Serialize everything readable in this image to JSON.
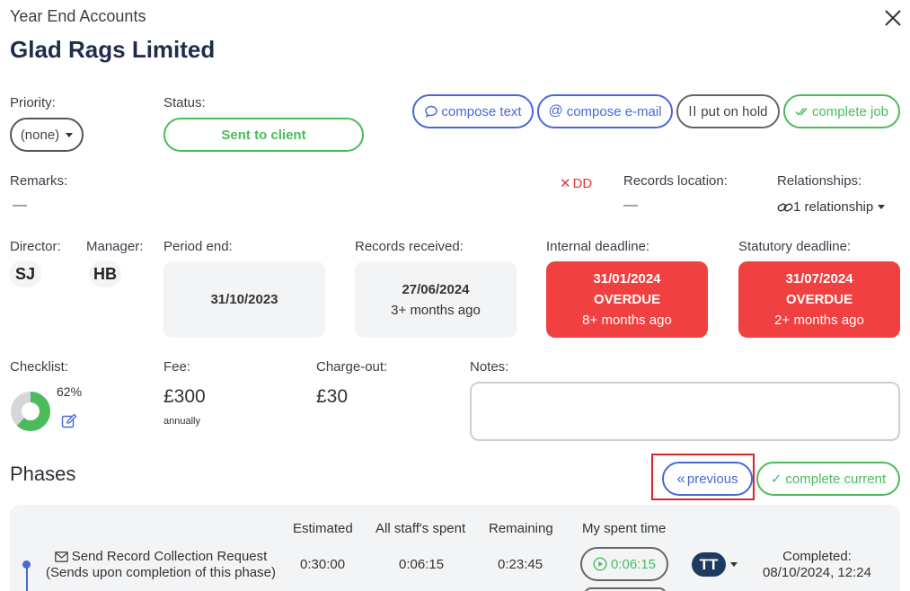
{
  "header": {
    "job_type": "Year End Accounts",
    "client_name": "Glad Rags Limited"
  },
  "priority": {
    "label": "Priority:",
    "value": "(none)"
  },
  "status": {
    "label": "Status:",
    "value": "Sent to client"
  },
  "actions": {
    "compose_text": "compose text",
    "compose_email": "compose e-mail",
    "put_on_hold": "put on hold",
    "complete_job": "complete job"
  },
  "remarks": {
    "label": "Remarks:",
    "value": "—"
  },
  "dd": {
    "label": "DD"
  },
  "records_location": {
    "label": "Records location:",
    "value": "—"
  },
  "relationships": {
    "label": "Relationships:",
    "value": "1 relationship"
  },
  "director": {
    "label": "Director:",
    "initials": "SJ"
  },
  "manager": {
    "label": "Manager:",
    "initials": "HB"
  },
  "period_end": {
    "label": "Period end:",
    "date": "31/10/2023"
  },
  "records_received": {
    "label": "Records received:",
    "date": "27/06/2024",
    "ago": "3+ months ago"
  },
  "internal_deadline": {
    "label": "Internal deadline:",
    "date": "31/01/2024",
    "state": "OVERDUE",
    "ago": "8+ months ago"
  },
  "statutory_deadline": {
    "label": "Statutory deadline:",
    "date": "31/07/2024",
    "state": "OVERDUE",
    "ago": "2+ months ago"
  },
  "checklist": {
    "label": "Checklist:",
    "percent_text": "62%",
    "percent": 62
  },
  "fee": {
    "label": "Fee:",
    "amount": "£300",
    "frequency": "annually"
  },
  "charge_out": {
    "label": "Charge-out:",
    "amount": "£30"
  },
  "notes": {
    "label": "Notes:",
    "value": ""
  },
  "phases": {
    "title": "Phases",
    "previous": "previous",
    "complete_current": "complete current",
    "columns": {
      "estimated": "Estimated",
      "all_staff_spent": "All staff's spent",
      "remaining": "Remaining",
      "my_spent_time": "My spent time"
    },
    "rows": [
      {
        "name": "Send Record Collection Request",
        "subtitle": "(Sends upon completion of this phase)",
        "estimated": "0:30:00",
        "all_staff_spent": "0:06:15",
        "remaining": "0:23:45",
        "my_spent_time": "0:06:15",
        "assignee": "TT",
        "completed_label": "Completed:",
        "completed_at": "08/10/2024, 12:24"
      }
    ]
  },
  "colors": {
    "brand_navy": "#1e2d4a",
    "accent_blue": "#4a67d6",
    "success_green": "#4cbb5c",
    "overdue_red": "#f04040",
    "dd_red": "#e03a3a",
    "highlight_red": "#d9262a",
    "panel_gray": "#f3f4f6"
  }
}
